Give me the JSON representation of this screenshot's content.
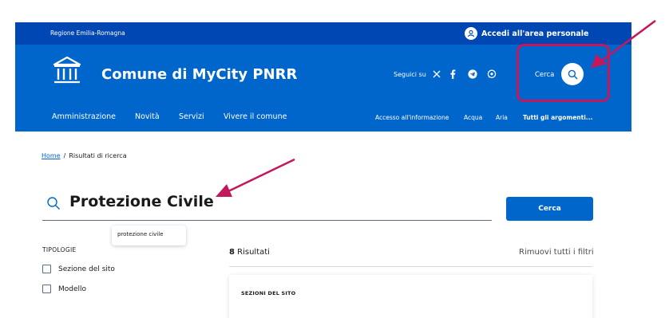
{
  "header": {
    "region_link": "Regione Emilia-Romagna",
    "login_label": "Accedi all'area personale",
    "site_title": "Comune di MyCity PNRR",
    "social_label": "Seguici su",
    "search_label": "Cerca"
  },
  "nav": {
    "main": [
      "Amministrazione",
      "Novità",
      "Servizi",
      "Vivere il comune"
    ],
    "secondary": [
      "Accesso all'informazione",
      "Acqua",
      "Aria"
    ],
    "all_topics": "Tutti gli argomenti..."
  },
  "breadcrumb": {
    "home": "Home",
    "separator": "/",
    "current": "Risultati di ricerca"
  },
  "search": {
    "value": "Protezione Civile",
    "submit_label": "Cerca",
    "suggestion": "protezione civile"
  },
  "filters": {
    "title": "TIPOLOGIE",
    "items": [
      "Sezione del sito",
      "Modello"
    ]
  },
  "results": {
    "count": "8",
    "count_label": "Risultati",
    "reset_label": "Rimuovi tutti i filtri",
    "cards": [
      {
        "category": "SEZIONI DEL SITO"
      }
    ]
  },
  "colors": {
    "slim_header": "#0047b3",
    "primary": "#0066cc",
    "annotation": "#c4185c"
  },
  "icons": [
    "user-icon",
    "pa-building-logo",
    "x-icon",
    "facebook-icon",
    "telegram-icon",
    "whatsapp-icon",
    "search-icon"
  ]
}
